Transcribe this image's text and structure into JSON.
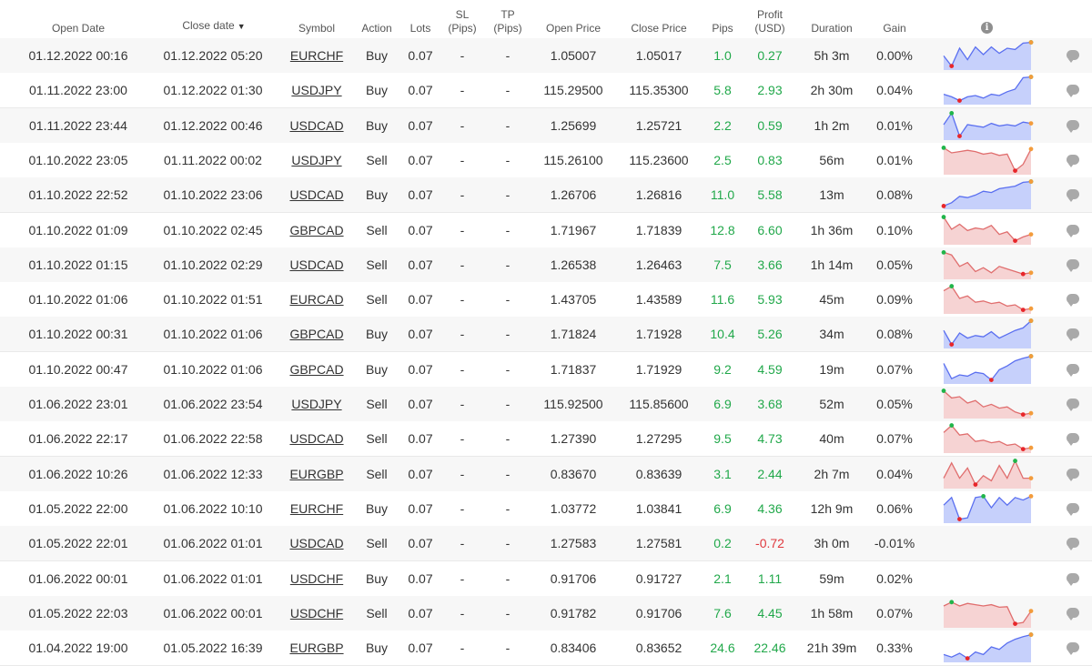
{
  "columns": {
    "open_date": "Open Date",
    "close_date": "Close date",
    "sort_arrow": "▼",
    "symbol": "Symbol",
    "action": "Action",
    "lots": "Lots",
    "sl_line1": "SL",
    "sl_line2": "(Pips)",
    "tp_line1": "TP",
    "tp_line2": "(Pips)",
    "open_price": "Open Price",
    "close_price": "Close Price",
    "pips": "Pips",
    "profit_line1": "Profit",
    "profit_line2": "(USD)",
    "duration": "Duration",
    "gain": "Gain",
    "info_icon": "i"
  },
  "colors": {
    "buy_line": "#5a6ff0",
    "buy_fill": "#c6d0fb",
    "sell_line": "#e06e6e",
    "sell_fill": "#f6d3d3",
    "marker_start": "#21b54a",
    "marker_min": "#e8262a",
    "marker_end": "#f39c3c",
    "positive": "#21a84a",
    "negative": "#e0393e"
  },
  "rows": [
    {
      "open": "01.12.2022 00:16",
      "close": "01.12.2022 05:20",
      "symbol": "EURCHF",
      "action": "Buy",
      "lots": "0.07",
      "sl": "-",
      "tp": "-",
      "open_price": "1.05007",
      "close_price": "1.05017",
      "pips": "1.0",
      "profit": "0.27",
      "duration": "5h 3m",
      "gain": "0.00%",
      "spark": [
        0.45,
        0.05,
        0.75,
        0.3,
        0.8,
        0.5,
        0.8,
        0.55,
        0.75,
        0.7,
        0.95,
        0.98
      ]
    },
    {
      "open": "01.11.2022 23:00",
      "close": "01.12.2022 01:30",
      "symbol": "USDJPY",
      "action": "Buy",
      "lots": "0.07",
      "sl": "-",
      "tp": "-",
      "open_price": "115.29500",
      "close_price": "115.35300",
      "pips": "5.8",
      "profit": "2.93",
      "duration": "2h 30m",
      "gain": "0.04%",
      "spark": [
        0.3,
        0.2,
        0.05,
        0.2,
        0.25,
        0.15,
        0.3,
        0.25,
        0.4,
        0.5,
        0.95,
        0.98
      ]
    },
    {
      "open": "01.11.2022 23:44",
      "close": "01.12.2022 00:46",
      "symbol": "USDCAD",
      "action": "Buy",
      "lots": "0.07",
      "sl": "-",
      "tp": "-",
      "open_price": "1.25699",
      "close_price": "1.25721",
      "pips": "2.2",
      "profit": "0.59",
      "duration": "1h 2m",
      "gain": "0.01%",
      "spark": [
        0.5,
        0.95,
        0.05,
        0.5,
        0.45,
        0.4,
        0.55,
        0.45,
        0.5,
        0.45,
        0.6,
        0.55
      ]
    },
    {
      "open": "01.10.2022 23:05",
      "close": "01.11.2022 00:02",
      "symbol": "USDJPY",
      "action": "Sell",
      "lots": "0.07",
      "sl": "-",
      "tp": "-",
      "open_price": "115.26100",
      "close_price": "115.23600",
      "pips": "2.5",
      "profit": "0.83",
      "duration": "56m",
      "gain": "0.01%",
      "spark": [
        0.95,
        0.75,
        0.8,
        0.85,
        0.8,
        0.7,
        0.75,
        0.65,
        0.7,
        0.05,
        0.3,
        0.9
      ]
    },
    {
      "open": "01.10.2022 22:52",
      "close": "01.10.2022 23:06",
      "symbol": "USDCAD",
      "action": "Buy",
      "lots": "0.07",
      "sl": "-",
      "tp": "-",
      "open_price": "1.26706",
      "close_price": "1.26816",
      "pips": "11.0",
      "profit": "5.58",
      "duration": "13m",
      "gain": "0.08%",
      "spark": [
        0.02,
        0.15,
        0.4,
        0.35,
        0.45,
        0.6,
        0.55,
        0.7,
        0.75,
        0.8,
        0.95,
        0.98
      ]
    },
    {
      "open": "01.10.2022 01:09",
      "close": "01.10.2022 02:45",
      "symbol": "GBPCAD",
      "action": "Sell",
      "lots": "0.07",
      "sl": "-",
      "tp": "-",
      "open_price": "1.71967",
      "close_price": "1.71839",
      "pips": "12.8",
      "profit": "6.60",
      "duration": "1h 36m",
      "gain": "0.10%",
      "spark": [
        0.98,
        0.5,
        0.7,
        0.45,
        0.55,
        0.5,
        0.65,
        0.3,
        0.4,
        0.05,
        0.2,
        0.3
      ]
    },
    {
      "open": "01.10.2022 01:15",
      "close": "01.10.2022 02:29",
      "symbol": "USDCAD",
      "action": "Sell",
      "lots": "0.07",
      "sl": "-",
      "tp": "-",
      "open_price": "1.26538",
      "close_price": "1.26463",
      "pips": "7.5",
      "profit": "3.66",
      "duration": "1h 14m",
      "gain": "0.05%",
      "spark": [
        0.95,
        0.85,
        0.4,
        0.55,
        0.2,
        0.35,
        0.15,
        0.4,
        0.3,
        0.2,
        0.1,
        0.15
      ]
    },
    {
      "open": "01.10.2022 01:06",
      "close": "01.10.2022 01:51",
      "symbol": "EURCAD",
      "action": "Sell",
      "lots": "0.07",
      "sl": "-",
      "tp": "-",
      "open_price": "1.43705",
      "close_price": "1.43589",
      "pips": "11.6",
      "profit": "5.93",
      "duration": "45m",
      "gain": "0.09%",
      "spark": [
        0.8,
        0.98,
        0.5,
        0.6,
        0.35,
        0.4,
        0.3,
        0.35,
        0.2,
        0.25,
        0.05,
        0.1
      ]
    },
    {
      "open": "01.10.2022 00:31",
      "close": "01.10.2022 01:06",
      "symbol": "GBPCAD",
      "action": "Buy",
      "lots": "0.07",
      "sl": "-",
      "tp": "-",
      "open_price": "1.71824",
      "close_price": "1.71928",
      "pips": "10.4",
      "profit": "5.26",
      "duration": "34m",
      "gain": "0.08%",
      "spark": [
        0.6,
        0.05,
        0.5,
        0.3,
        0.4,
        0.35,
        0.55,
        0.3,
        0.45,
        0.6,
        0.7,
        0.98
      ]
    },
    {
      "open": "01.10.2022 00:47",
      "close": "01.10.2022 01:06",
      "symbol": "GBPCAD",
      "action": "Buy",
      "lots": "0.07",
      "sl": "-",
      "tp": "-",
      "open_price": "1.71837",
      "close_price": "1.71929",
      "pips": "9.2",
      "profit": "4.59",
      "duration": "19m",
      "gain": "0.07%",
      "spark": [
        0.7,
        0.1,
        0.25,
        0.2,
        0.35,
        0.3,
        0.05,
        0.45,
        0.6,
        0.8,
        0.9,
        0.98
      ]
    },
    {
      "open": "01.06.2022 23:01",
      "close": "01.06.2022 23:54",
      "symbol": "USDJPY",
      "action": "Sell",
      "lots": "0.07",
      "sl": "-",
      "tp": "-",
      "open_price": "115.92500",
      "close_price": "115.85600",
      "pips": "6.9",
      "profit": "3.68",
      "duration": "52m",
      "gain": "0.05%",
      "spark": [
        0.98,
        0.7,
        0.75,
        0.5,
        0.6,
        0.35,
        0.45,
        0.3,
        0.35,
        0.15,
        0.05,
        0.1
      ]
    },
    {
      "open": "01.06.2022 22:17",
      "close": "01.06.2022 22:58",
      "symbol": "USDCAD",
      "action": "Sell",
      "lots": "0.07",
      "sl": "-",
      "tp": "-",
      "open_price": "1.27390",
      "close_price": "1.27295",
      "pips": "9.5",
      "profit": "4.73",
      "duration": "40m",
      "gain": "0.07%",
      "spark": [
        0.7,
        0.98,
        0.6,
        0.65,
        0.35,
        0.4,
        0.3,
        0.35,
        0.2,
        0.25,
        0.05,
        0.1
      ]
    },
    {
      "open": "01.06.2022 10:26",
      "close": "01.06.2022 12:33",
      "symbol": "EURGBP",
      "action": "Sell",
      "lots": "0.07",
      "sl": "-",
      "tp": "-",
      "open_price": "0.83670",
      "close_price": "0.83639",
      "pips": "3.1",
      "profit": "2.44",
      "duration": "2h 7m",
      "gain": "0.04%",
      "spark": [
        0.3,
        0.9,
        0.3,
        0.7,
        0.05,
        0.4,
        0.2,
        0.8,
        0.3,
        0.98,
        0.3,
        0.3
      ]
    },
    {
      "open": "01.05.2022 22:00",
      "close": "01.06.2022 10:10",
      "symbol": "EURCHF",
      "action": "Buy",
      "lots": "0.07",
      "sl": "-",
      "tp": "-",
      "open_price": "1.03772",
      "close_price": "1.03841",
      "pips": "6.9",
      "profit": "4.36",
      "duration": "12h 9m",
      "gain": "0.06%",
      "spark": [
        0.6,
        0.9,
        0.05,
        0.1,
        0.9,
        0.95,
        0.5,
        0.9,
        0.6,
        0.9,
        0.8,
        0.95
      ]
    },
    {
      "open": "01.05.2022 22:01",
      "close": "01.06.2022 01:01",
      "symbol": "USDCAD",
      "action": "Sell",
      "lots": "0.07",
      "sl": "-",
      "tp": "-",
      "open_price": "1.27583",
      "close_price": "1.27581",
      "pips": "0.2",
      "profit": "-0.72",
      "duration": "3h 0m",
      "gain": "-0.01%",
      "spark": null
    },
    {
      "open": "01.06.2022 00:01",
      "close": "01.06.2022 01:01",
      "symbol": "USDCHF",
      "action": "Buy",
      "lots": "0.07",
      "sl": "-",
      "tp": "-",
      "open_price": "0.91706",
      "close_price": "0.91727",
      "pips": "2.1",
      "profit": "1.11",
      "duration": "59m",
      "gain": "0.02%",
      "spark": null
    },
    {
      "open": "01.05.2022 22:03",
      "close": "01.06.2022 00:01",
      "symbol": "USDCHF",
      "action": "Sell",
      "lots": "0.07",
      "sl": "-",
      "tp": "-",
      "open_price": "0.91782",
      "close_price": "0.91706",
      "pips": "7.6",
      "profit": "4.45",
      "duration": "1h 58m",
      "gain": "0.07%",
      "spark": [
        0.75,
        0.9,
        0.75,
        0.85,
        0.8,
        0.75,
        0.8,
        0.7,
        0.72,
        0.05,
        0.1,
        0.55
      ]
    },
    {
      "open": "01.04.2022 19:00",
      "close": "01.05.2022 16:39",
      "symbol": "EURGBP",
      "action": "Buy",
      "lots": "0.07",
      "sl": "-",
      "tp": "-",
      "open_price": "0.83406",
      "close_price": "0.83652",
      "pips": "24.6",
      "profit": "22.46",
      "duration": "21h 39m",
      "gain": "0.33%",
      "spark": [
        0.2,
        0.1,
        0.25,
        0.05,
        0.3,
        0.2,
        0.5,
        0.4,
        0.65,
        0.8,
        0.9,
        0.98
      ]
    }
  ]
}
